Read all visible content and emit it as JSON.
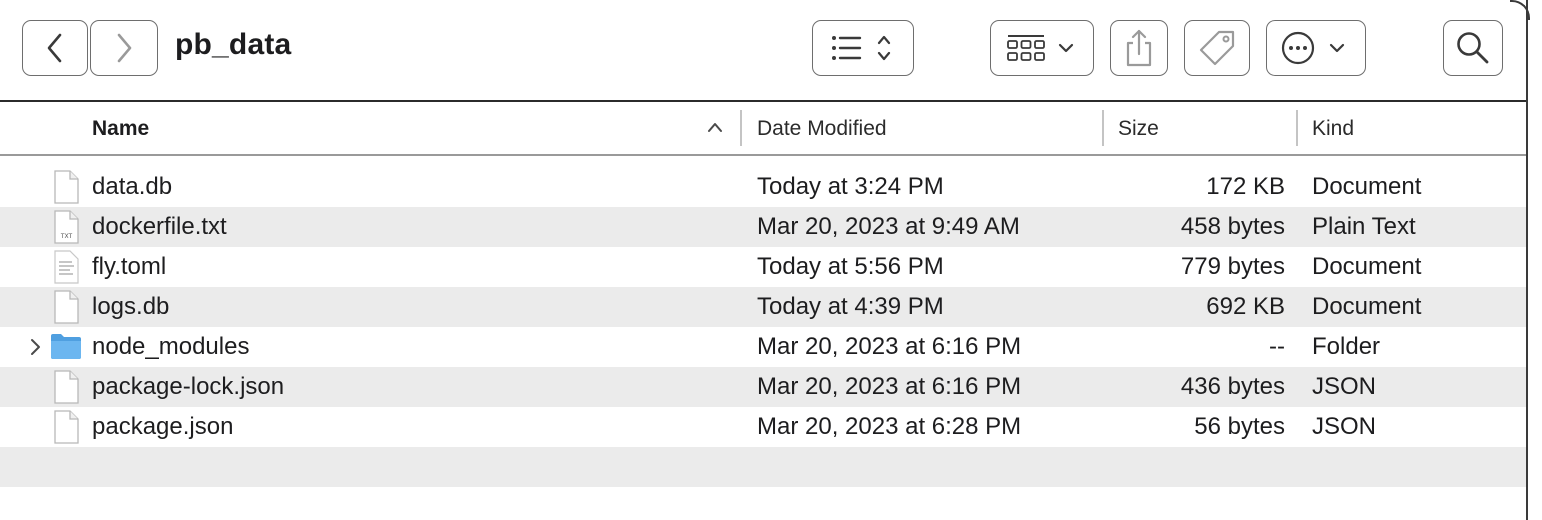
{
  "window": {
    "title": "pb_data"
  },
  "toolbar": {
    "back_icon": "chevron-left-icon",
    "forward_icon": "chevron-right-icon",
    "view_list_icon": "list-view-icon",
    "group_icon": "grid-group-icon",
    "share_icon": "share-icon",
    "tag_icon": "tag-icon",
    "more_icon": "ellipsis-circle-icon",
    "search_icon": "search-icon"
  },
  "columns": {
    "name": "Name",
    "date": "Date Modified",
    "size": "Size",
    "kind": "Kind"
  },
  "files": [
    {
      "name": "data.db",
      "date": "Today at 3:24 PM",
      "size": "172 KB",
      "kind": "Document",
      "icon": "document-icon"
    },
    {
      "name": "dockerfile.txt",
      "date": "Mar 20, 2023 at 9:49 AM",
      "size": "458 bytes",
      "kind": "Plain Text",
      "icon": "txt-file-icon"
    },
    {
      "name": "fly.toml",
      "date": "Today at 5:56 PM",
      "size": "779 bytes",
      "kind": "Document",
      "icon": "text-document-icon"
    },
    {
      "name": "logs.db",
      "date": "Today at 4:39 PM",
      "size": "692 KB",
      "kind": "Document",
      "icon": "document-icon"
    },
    {
      "name": "node_modules",
      "date": "Mar 20, 2023 at 6:16 PM",
      "size": "--",
      "kind": "Folder",
      "icon": "folder-icon"
    },
    {
      "name": "package-lock.json",
      "date": "Mar 20, 2023 at 6:16 PM",
      "size": "436 bytes",
      "kind": "JSON",
      "icon": "document-icon"
    },
    {
      "name": "package.json",
      "date": "Mar 20, 2023 at 6:28 PM",
      "size": "56 bytes",
      "kind": "JSON",
      "icon": "document-icon"
    }
  ],
  "colors": {
    "row_alt": "#ebebeb",
    "folder": "#5aa9e6",
    "text": "#1d1d1f"
  }
}
